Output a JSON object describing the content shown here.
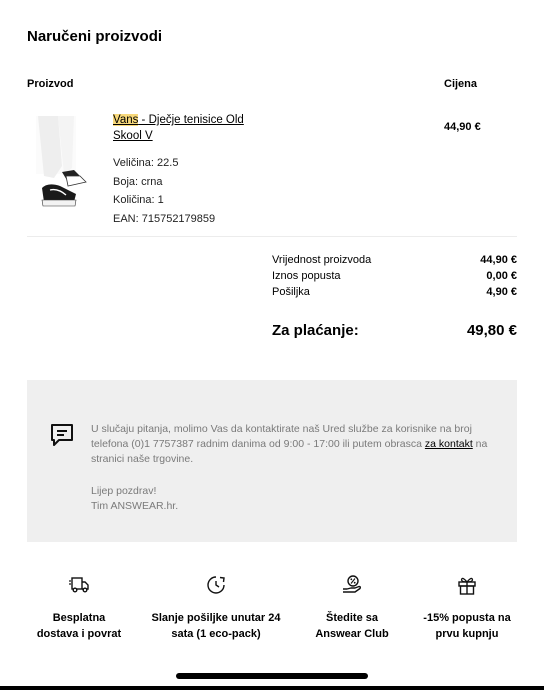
{
  "page": {
    "title": "Naručeni proizvodi"
  },
  "table": {
    "product_header": "Proizvod",
    "price_header": "Cijena"
  },
  "product": {
    "brand": "Vans",
    "name_rest": " - Dječje tenisice Old Skool V",
    "price": "44,90 €",
    "size": "Veličina: 22.5",
    "color": "Boja: crna",
    "quantity": "Količina: 1",
    "ean": "EAN: 715752179859",
    "highlight_color": "#f7d87a"
  },
  "summary": {
    "rows": [
      {
        "label": "Vrijednost proizvoda",
        "value": "44,90 €"
      },
      {
        "label": "Iznos popusta",
        "value": "0,00 €"
      },
      {
        "label": "Pošiljka",
        "value": "4,90 €"
      }
    ],
    "total_label": "Za plaćanje:",
    "total_value": "49,80 €"
  },
  "contact": {
    "text_before_link": "U slučaju pitanja, molimo Vas da kontaktirate naš Ured službe za korisnike na broj telefona (0)1 7757387 radnim danima od 9:00 - 17:00 ili putem obrasca ",
    "link_text": "za kontakt",
    "text_after_link": " na stranici naše trgovine.",
    "greeting_line1": "Lijep pozdrav!",
    "greeting_line2": "Tim ANSWEAR.hr.",
    "icon": "chat-bubble-icon",
    "box_color": "#efefef"
  },
  "features": [
    {
      "icon": "delivery-truck-icon",
      "line1": "Besplatna",
      "line2": "dostava i povrat"
    },
    {
      "icon": "clock-icon",
      "line1": "Slanje pošiljke unutar 24",
      "line2": "sata (1 eco-pack)"
    },
    {
      "icon": "discount-hand-icon",
      "line1": "Štedite sa",
      "line2": "Answear Club"
    },
    {
      "icon": "gift-icon",
      "line1": "-15% popusta na",
      "line2": "prvu kupnju"
    }
  ]
}
